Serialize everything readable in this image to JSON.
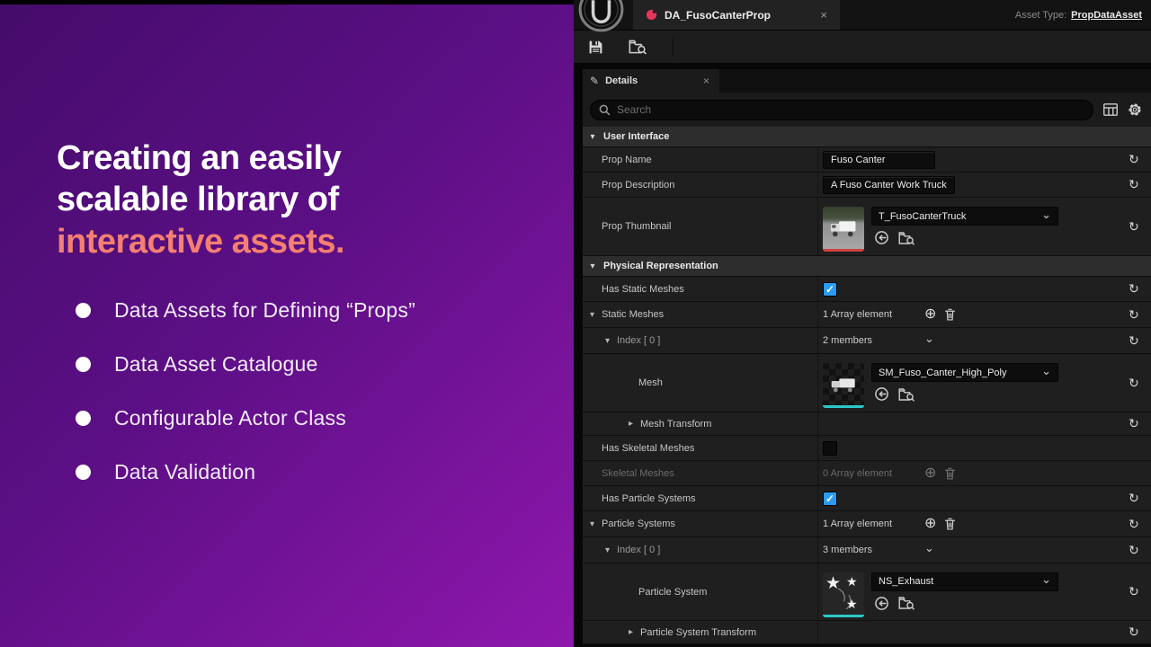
{
  "icons": {
    "reset": "↺",
    "plus": "⊕",
    "chevron_down": "⌄",
    "tri_down": "▾",
    "tri_right": "▸",
    "close": "×",
    "pencil": "✎",
    "star": "★",
    "trail": "⌒",
    "check": "✓"
  },
  "slide": {
    "title_line1": "Creating an easily",
    "title_line2": "scalable library of",
    "title_accent": "interactive assets.",
    "bullets": [
      "Data Assets for Defining “Props”",
      "Data Asset Catalogue",
      "Configurable Actor Class",
      "Data Validation"
    ],
    "colors": {
      "gradient_start": "#450c6b",
      "gradient_end": "#8f17ad",
      "accent": "#f47f72"
    }
  },
  "editor": {
    "tab_title": "DA_FusoCanterProp",
    "asset_type_label": "Asset Type:",
    "asset_type_value": "PropDataAsset",
    "details_tab": "Details",
    "search_placeholder": "Search",
    "colors": {
      "checkbox": "#2b9bf4",
      "mesh_underline": "#2bc8ca",
      "texture_underline": "#cf4141",
      "tab_icon": "#e8355c"
    },
    "rows": {
      "user_interface": "User Interface",
      "prop_name": {
        "label": "Prop Name",
        "value": "Fuso Canter"
      },
      "prop_description": {
        "label": "Prop Description",
        "value": "A Fuso Canter Work Truck"
      },
      "prop_thumbnail": {
        "label": "Prop Thumbnail",
        "asset": "T_FusoCanterTruck"
      },
      "physical_representation": "Physical Representation",
      "has_static_meshes": {
        "label": "Has Static Meshes",
        "checked": true
      },
      "static_meshes": {
        "label": "Static Meshes",
        "count": "1 Array element"
      },
      "static_index": {
        "label": "Index [ 0 ]",
        "count": "2 members"
      },
      "mesh": {
        "label": "Mesh",
        "asset": "SM_Fuso_Canter_High_Poly"
      },
      "mesh_transform": {
        "label": "Mesh Transform"
      },
      "has_skeletal_meshes": {
        "label": "Has Skeletal Meshes",
        "checked": false
      },
      "skeletal_meshes": {
        "label": "Skeletal Meshes",
        "count": "0 Array element"
      },
      "has_particle_systems": {
        "label": "Has Particle Systems",
        "checked": true
      },
      "particle_systems": {
        "label": "Particle Systems",
        "count": "1 Array element"
      },
      "particle_index": {
        "label": "Index [ 0 ]",
        "count": "3 members"
      },
      "particle_system": {
        "label": "Particle System",
        "asset": "NS_Exhaust"
      },
      "particle_system_transform": {
        "label": "Particle System Transform"
      }
    }
  }
}
